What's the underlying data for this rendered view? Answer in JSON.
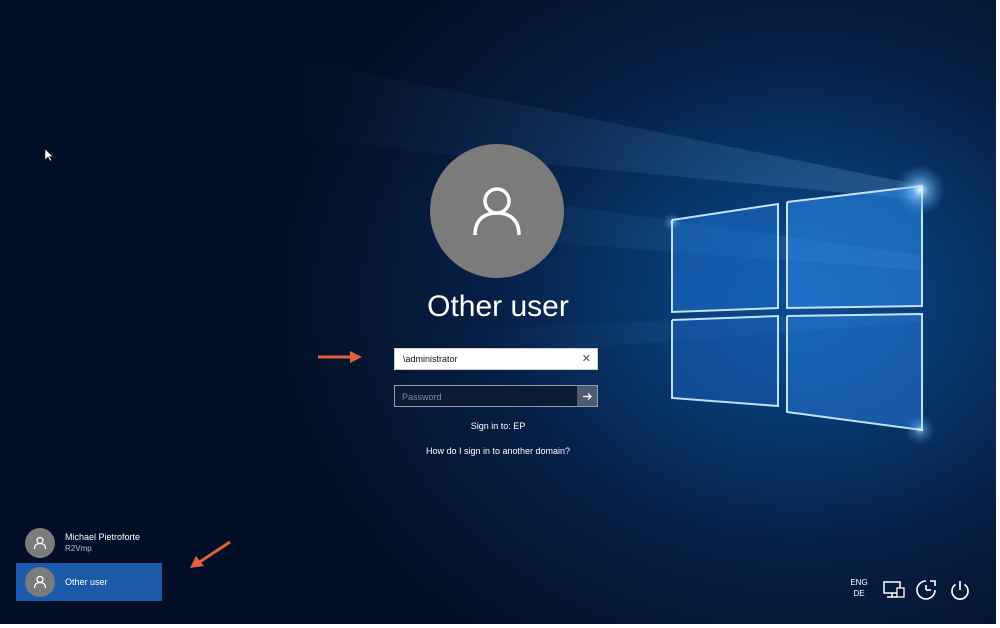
{
  "login": {
    "avatar_icon": "user-icon",
    "title": "Other user",
    "username_value": "\\administrator",
    "password_placeholder": "Password",
    "sign_in_to": "Sign in to: EP",
    "domain_help_link": "How do I sign in to another domain?"
  },
  "users": [
    {
      "name": "Michael Pietroforte",
      "sub": "R2Vmp",
      "selected": false
    },
    {
      "name": "Other user",
      "selected": true
    }
  ],
  "tray": {
    "lang_line1": "ENG",
    "lang_line2": "DE",
    "icons": [
      "network-icon",
      "ease-of-access-icon",
      "power-icon"
    ]
  },
  "colors": {
    "background": "#061f45",
    "selected_tile": "#1a5aa8",
    "annotation_arrow": "#e0603c",
    "avatar": "#7b7b7b"
  }
}
